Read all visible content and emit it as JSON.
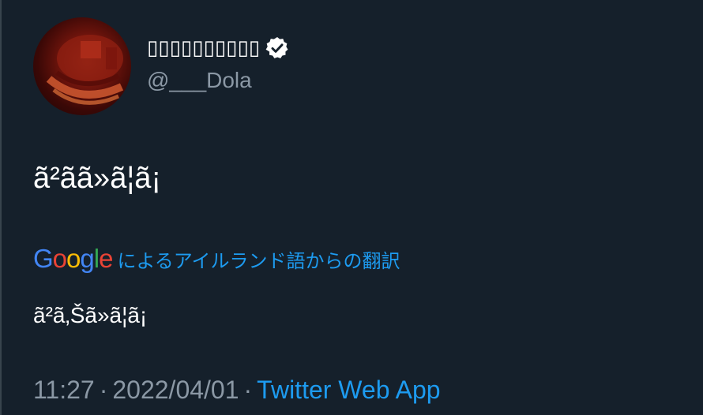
{
  "user": {
    "display_name": "",
    "display_name_shown": "▯▯▯▯▯▯▯▯▯▯",
    "handle": "@___Dola",
    "verified": true,
    "avatar_icon": "avatar-image"
  },
  "tweet": {
    "text": "ã²ãã»ã¦ã¡",
    "translate_prefix": "Google",
    "translate_label": "によるアイルランド語からの翻訳",
    "translated_text": "ã²ã‚Šã»ã¦ã¡",
    "time": "11:27",
    "separator": "·",
    "date": "2022/04/01",
    "source": "Twitter Web App"
  },
  "colors": {
    "background": "#15202b",
    "text_primary": "#ffffff",
    "text_secondary": "#8b98a5",
    "link": "#1d9bf0"
  }
}
